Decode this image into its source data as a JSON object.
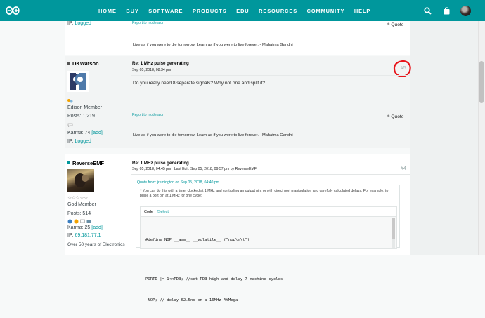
{
  "nav": {
    "links": [
      "HOME",
      "BUY",
      "SOFTWARE",
      "PRODUCTS",
      "EDU",
      "RESOURCES",
      "COMMUNITY",
      "HELP"
    ],
    "icons": [
      "search-icon",
      "bag-icon",
      "avatar"
    ]
  },
  "labels": {
    "ip": "IP:",
    "logged": "Logged",
    "report": "Report to moderator",
    "quote": "Quote",
    "karma": "Karma:",
    "add": "[add]",
    "posts": "Posts:",
    "code": "Code",
    "select": "[Select]",
    "last_edit": "Last Edit:"
  },
  "posts": [
    {
      "signature": "Live as if you were to die tomorrow. Learn as if you were to live forever. - Mahatma Gandhi"
    },
    {
      "author": "DKWatson",
      "rank": "Edison Member",
      "posts": "1,219",
      "karma": "74",
      "subject": "Re: 1 MHz pulse generating",
      "date": "Sep 05, 2018, 08:34 pm",
      "number": "#5",
      "body": "Do you really need 8 separate signals? Why not one and split it?",
      "signature": "Live as if you were to die tomorrow. Learn as if you were to live forever. - Mahatma Gandhi"
    },
    {
      "author": "ReverseEMF",
      "stars": "☆☆☆☆☆",
      "rank": "God Member",
      "posts": "514",
      "karma": "25",
      "ip": "69.181.77.1",
      "bio": "Over 50 years of Electronics",
      "subject": "Re: 1 MHz pulse generating",
      "date": "Sep 05, 2018, 04:45 pm",
      "last_edit": "Sep 05, 2018, 09:57 pm by ReverseEMF",
      "number": "#4",
      "quote_from": "Quote from: jremington on Sep 05, 2018, 04:40 pm",
      "quote_text": "You can do this with a timer clocked at 1 MHz and controlling an output pin, or with direct port manipulation and carefully calculated delays. For example, to pulse a port pin at 1 MHz for one cycle:",
      "code_lines": [
        "#define NOP __asm__ __volatile__ (\"nop\\n\\t\")",
        "",
        "PORTD |= 1<<PD3; //set PD3 high and delay 7 machine cycles",
        " NOP; // delay 62.5ns on a 16MHz AtMega"
      ]
    }
  ]
}
